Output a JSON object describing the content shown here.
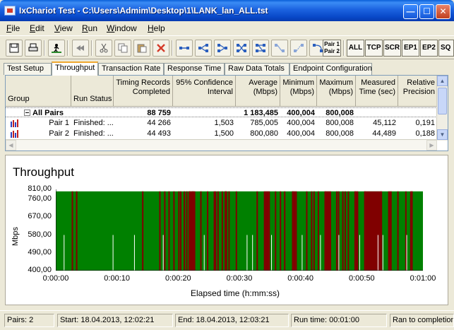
{
  "window": {
    "title": "IxChariot Test - C:\\Users\\Admim\\Desktop\\1\\LANK_lan_ALL.tst",
    "controls": [
      "minimize-icon",
      "maximize-icon",
      "close-icon"
    ]
  },
  "menu": [
    {
      "label": "File",
      "accel": "F",
      "rest": "ile"
    },
    {
      "label": "Edit",
      "accel": "E",
      "rest": "dit"
    },
    {
      "label": "View",
      "accel": "V",
      "rest": "iew"
    },
    {
      "label": "Run",
      "accel": "R",
      "rest": "un"
    },
    {
      "label": "Window",
      "accel": "W",
      "rest": "indow"
    },
    {
      "label": "Help",
      "accel": "H",
      "rest": "elp"
    }
  ],
  "toolbar": {
    "icons": [
      "save-icon",
      "print-icon",
      "run-icon",
      "rewind-icon",
      "cut-icon",
      "copy-icon",
      "paste-icon",
      "delete-icon",
      "pair-link-icon",
      "pair-split-icon",
      "pair-group-icon",
      "pair-swap-icon",
      "pair-multi-icon",
      "pair-edit-icon",
      "pair-dash-icon",
      "pair-refresh-icon"
    ],
    "pair_button": {
      "line1": "Pair 1",
      "line2": "Pair 2"
    },
    "text_buttons": [
      "ALL",
      "TCP",
      "SCR",
      "EP1",
      "EP2",
      "SQ"
    ]
  },
  "tabs": [
    "Test Setup",
    "Throughput",
    "Transaction Rate",
    "Response Time",
    "Raw Data Totals",
    "Endpoint Configuration"
  ],
  "active_tab": "Throughput",
  "grid": {
    "headers": [
      {
        "line1": "",
        "line2": "Group"
      },
      {
        "line1": "",
        "line2": "Run Status"
      },
      {
        "line1": "Timing Records",
        "line2": "Completed"
      },
      {
        "line1": "95% Confidence",
        "line2": "Interval"
      },
      {
        "line1": "Average",
        "line2": "(Mbps)"
      },
      {
        "line1": "Minimum",
        "line2": "(Mbps)"
      },
      {
        "line1": "Maximum",
        "line2": "(Mbps)"
      },
      {
        "line1": "Measured",
        "line2": "Time (sec)"
      },
      {
        "line1": "Relative",
        "line2": "Precision"
      }
    ],
    "rows": [
      {
        "group": "All Pairs",
        "status": "",
        "records": "88 759",
        "ci": "",
        "avg": "1 183,485",
        "min": "400,004",
        "max": "800,008",
        "time": "",
        "precision": ""
      },
      {
        "group": "Pair 1",
        "status": "Finished: ...",
        "records": "44 266",
        "ci": "1,503",
        "avg": "785,005",
        "min": "400,004",
        "max": "800,008",
        "time": "45,112",
        "precision": "0,191"
      },
      {
        "group": "Pair 2",
        "status": "Finished: ...",
        "records": "44 493",
        "ci": "1,500",
        "avg": "800,080",
        "min": "400,004",
        "max": "800,008",
        "time": "44,489",
        "precision": "0,188"
      }
    ]
  },
  "chart_data": {
    "type": "bar",
    "title": "Throughput",
    "xlabel": "Elapsed time (h:mm:ss)",
    "ylabel": "Mbps",
    "ylim": [
      400,
      810
    ],
    "xlim": [
      0,
      60
    ],
    "yticks": [
      "810,00",
      "760,00",
      "670,00",
      "580,00",
      "490,00",
      "400,00"
    ],
    "ytick_values": [
      810,
      760,
      670,
      580,
      490,
      400
    ],
    "xticks": [
      "0:00:00",
      "0:00:10",
      "0:00:20",
      "0:00:30",
      "0:00:40",
      "0:00:50",
      "0:01:00"
    ],
    "xtick_values": [
      0,
      10,
      20,
      30,
      40,
      50,
      60
    ],
    "series": [
      {
        "name": "Pair 1",
        "color": "#800000"
      },
      {
        "name": "Pair 2",
        "color": "#008000"
      }
    ],
    "pair2_level": 800,
    "pair1_level": 800,
    "pair1_spikes_sec": [
      2.6,
      3.3,
      14.1,
      16.9,
      17.7,
      18.4,
      19.2,
      20.0,
      20.3,
      20.9,
      21.3,
      21.7,
      22.3,
      23.6,
      24.7,
      25.8,
      26.0,
      26.4,
      27.1,
      27.6,
      28.2,
      29.4,
      32.8,
      35.8,
      36.6,
      37.3,
      38.6,
      40.9,
      41.7,
      42.1,
      42.8,
      43.9,
      45.8,
      46.1,
      46.8,
      47.2,
      47.7,
      48.8,
      49.2,
      50.4,
      53.1,
      55.8,
      57.1,
      58.1
    ],
    "pair1_bands_sec": [
      [
        21.8,
        22.8
      ],
      [
        27.6,
        28.0
      ],
      [
        34.0,
        35.0
      ],
      [
        38.6,
        39.4
      ],
      [
        44.0,
        45.0
      ],
      [
        48.8,
        49.3
      ],
      [
        50.4,
        53.2
      ],
      [
        54.3,
        54.9
      ],
      [
        57.9,
        58.3
      ]
    ],
    "drop_spikes_sec": [
      1.3,
      9.3,
      12.8,
      17.5,
      24.2,
      31.2,
      32.1,
      35.2,
      40.2,
      43.2,
      46.2,
      49.6,
      52.6,
      53.4,
      57.3
    ],
    "drop_min": 400
  },
  "status": {
    "pairs": "Pairs: 2",
    "start": "Start: 18.04.2013, 12:02:21",
    "end": "End: 18.04.2013, 12:03:21",
    "runtime": "Run time: 00:01:00",
    "state": "Ran to completion"
  }
}
